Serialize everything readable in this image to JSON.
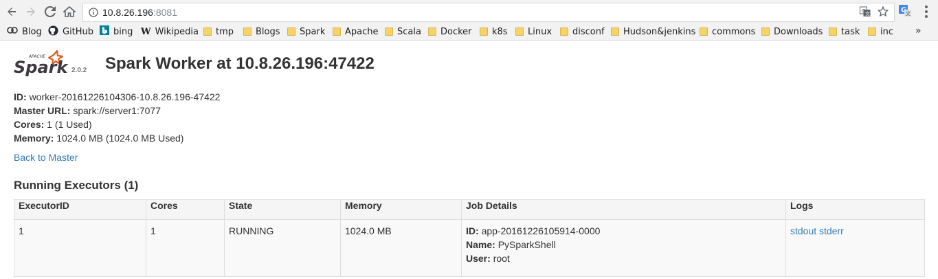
{
  "browser": {
    "url_host": "10.8.26.196",
    "url_port": ":8081",
    "icons": {
      "back": "arrow-left-icon",
      "forward": "arrow-right-icon",
      "reload": "reload-icon",
      "home": "home-icon",
      "info": "info-icon",
      "translate": "translate-icon",
      "star": "star-icon",
      "extension": "google-translate-extension-icon",
      "menu": "kebab-menu-icon"
    },
    "bookmarks": [
      {
        "label": "Blog",
        "icon": "blog-icon"
      },
      {
        "label": "GitHub",
        "icon": "github-icon"
      },
      {
        "label": "bing",
        "icon": "bing-icon"
      },
      {
        "label": "Wikipedia",
        "icon": "wikipedia-icon"
      },
      {
        "label": "tmp",
        "icon": "folder-icon"
      },
      {
        "label": "Blogs",
        "icon": "folder-icon"
      },
      {
        "label": "Spark",
        "icon": "folder-icon"
      },
      {
        "label": "Apache",
        "icon": "folder-icon"
      },
      {
        "label": "Scala",
        "icon": "folder-icon"
      },
      {
        "label": "Docker",
        "icon": "folder-icon"
      },
      {
        "label": "k8s",
        "icon": "folder-icon"
      },
      {
        "label": "Linux",
        "icon": "folder-icon"
      },
      {
        "label": "disconf",
        "icon": "folder-icon"
      },
      {
        "label": "Hudson&jenkins",
        "icon": "folder-icon"
      },
      {
        "label": "commons",
        "icon": "folder-icon"
      },
      {
        "label": "Downloads",
        "icon": "folder-icon"
      },
      {
        "label": "task",
        "icon": "folder-icon"
      },
      {
        "label": "inc",
        "icon": "folder-icon"
      }
    ],
    "overflow_label": "»"
  },
  "page": {
    "logo_apache": "APACHE",
    "logo_spark": "Spark",
    "version": "2.0.2",
    "title": "Spark Worker at 10.8.26.196:47422",
    "summary": [
      {
        "label": "ID:",
        "value": "worker-20161226104306-10.8.26.196-47422"
      },
      {
        "label": "Master URL:",
        "value": "spark://server1:7077"
      },
      {
        "label": "Cores:",
        "value": "1 (1 Used)"
      },
      {
        "label": "Memory:",
        "value": "1024.0 MB (1024.0 MB Used)"
      }
    ],
    "back_link": "Back to Master",
    "section_title": "Running Executors (1)",
    "table": {
      "headers": [
        "ExecutorID",
        "Cores",
        "State",
        "Memory",
        "Job Details",
        "Logs"
      ],
      "rows": [
        {
          "executor_id": "1",
          "cores": "1",
          "state": "RUNNING",
          "memory": "1024.0 MB",
          "job_details": [
            {
              "label": "ID:",
              "value": "app-20161226105914-0000"
            },
            {
              "label": "Name:",
              "value": "PySparkShell"
            },
            {
              "label": "User:",
              "value": "root"
            }
          ],
          "logs": [
            "stdout",
            "stderr"
          ]
        }
      ]
    }
  },
  "colors": {
    "link": "#337ab7",
    "text": "#333333",
    "spark_orange": "#e25a1c",
    "spark_text": "#3c3a3e"
  }
}
